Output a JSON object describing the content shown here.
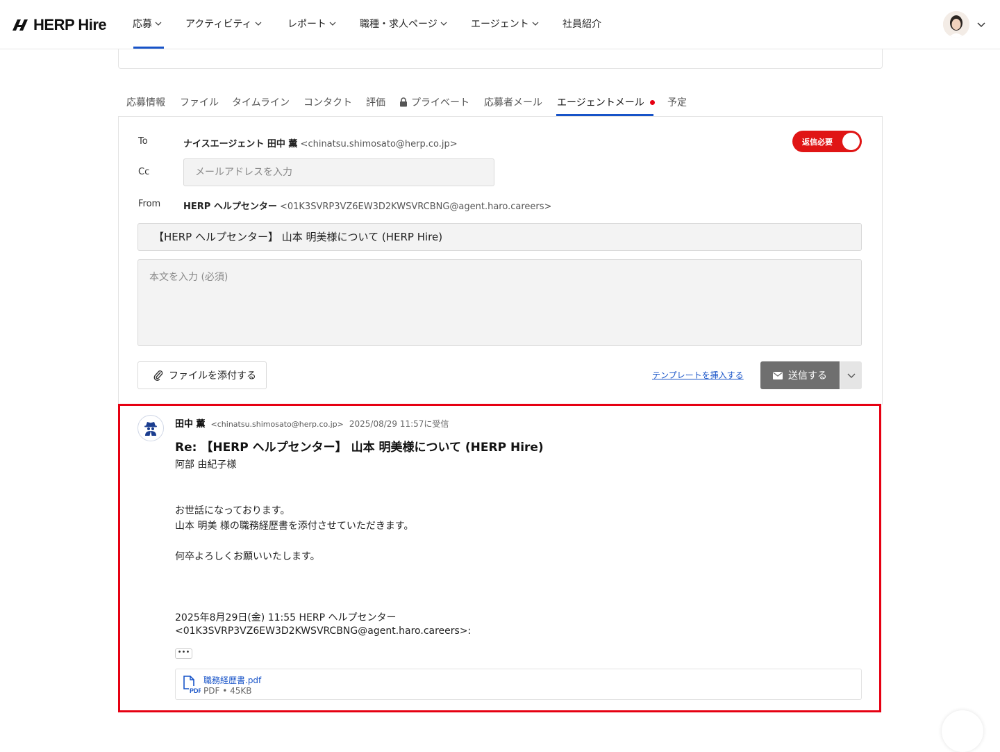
{
  "header": {
    "logo_text": "HERP Hire",
    "nav": [
      {
        "label": "応募",
        "dropdown": true
      },
      {
        "label": "アクティビティ",
        "dropdown": true
      },
      {
        "label": "レポート",
        "dropdown": true
      },
      {
        "label": "職種・求人ページ",
        "dropdown": true
      },
      {
        "label": "エージェント",
        "dropdown": true
      },
      {
        "label": "社員紹介",
        "dropdown": false
      }
    ],
    "active_nav": "応募"
  },
  "tabs": [
    {
      "label": "応募情報"
    },
    {
      "label": "ファイル"
    },
    {
      "label": "タイムライン"
    },
    {
      "label": "コンタクト"
    },
    {
      "label": "評価"
    },
    {
      "label": "プライベート",
      "icon": "lock-icon"
    },
    {
      "label": "応募者メール"
    },
    {
      "label": "エージェントメール",
      "active": true,
      "notification_dot": true
    },
    {
      "label": "予定"
    }
  ],
  "composer": {
    "to_label": "To",
    "to_name": "ナイスエージェント 田中 薫",
    "to_email": "<chinatsu.shimosato@herp.co.jp>",
    "reply_toggle_label": "返信必要",
    "reply_toggle_on": true,
    "cc_label": "Cc",
    "cc_placeholder": "メールアドレスを入力",
    "from_label": "From",
    "from_name": "HERP ヘルプセンター",
    "from_email": "<01K3SVRP3VZ6EW3D2KWSVRCBNG@agent.haro.careers>",
    "subject_value": "【HERP ヘルプセンター】 山本 明美様について (HERP Hire)",
    "body_placeholder": "本文を入力 (必須)",
    "attach_label": "ファイルを添付する",
    "template_link": "テンプレートを挿入する",
    "send_label": "送信する"
  },
  "message": {
    "sender": "田中 薫",
    "email": "<chinatsu.shimosato@herp.co.jp>",
    "received": "2025/08/29 11:57に受信",
    "subject": "Re: 【HERP ヘルプセンター】 山本 明美様について (HERP Hire)",
    "greeting": "阿部 由紀子様",
    "body_line1": "お世話になっております。",
    "body_line2": "山本 明美 様の職務経歴書を添付させていただきます。",
    "body_line3": "何卒よろしくお願いいたします。",
    "quote_line1": "2025年8月29日(金) 11:55 HERP ヘルプセンター",
    "quote_line2": "<01K3SVRP3VZ6EW3D2KWSVRCBNG@agent.haro.careers>:",
    "expand_label": "•••",
    "attachment": {
      "name": "職務経歴書.pdf",
      "meta": "PDF • 45KB",
      "icon_label": "PDF"
    }
  },
  "colors": {
    "accent": "#1753c8",
    "highlight": "#e60012",
    "toggle_on": "#e01515"
  }
}
